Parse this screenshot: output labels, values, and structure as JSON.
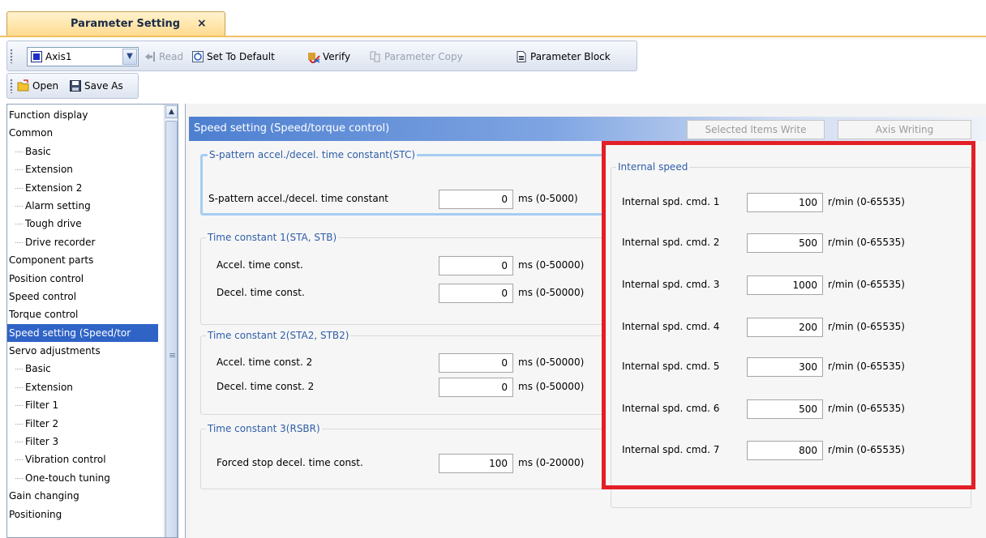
{
  "tab": {
    "title": "Parameter Setting",
    "close": "×"
  },
  "toolbar1": {
    "axis": "Axis1",
    "read": "Read",
    "set_to_default": "Set To Default",
    "verify": "Verify",
    "parameter_copy": "Parameter Copy",
    "parameter_block": "Parameter Block"
  },
  "toolbar2": {
    "open": "Open",
    "save_as": "Save As"
  },
  "tree": {
    "items": [
      {
        "label": "Function display",
        "level": 0
      },
      {
        "label": "Common",
        "level": 0
      },
      {
        "label": "Basic",
        "level": 1
      },
      {
        "label": "Extension",
        "level": 1
      },
      {
        "label": "Extension 2",
        "level": 1
      },
      {
        "label": "Alarm setting",
        "level": 1
      },
      {
        "label": "Tough drive",
        "level": 1
      },
      {
        "label": "Drive recorder",
        "level": 1
      },
      {
        "label": "Component parts",
        "level": 0
      },
      {
        "label": "Position control",
        "level": 0
      },
      {
        "label": "Speed control",
        "level": 0
      },
      {
        "label": "Torque control",
        "level": 0
      },
      {
        "label": "Speed setting (Speed/tor",
        "level": 0,
        "selected": true
      },
      {
        "label": "Servo adjustments",
        "level": 0
      },
      {
        "label": "Basic",
        "level": 1
      },
      {
        "label": "Extension",
        "level": 1
      },
      {
        "label": "Filter 1",
        "level": 1
      },
      {
        "label": "Filter 2",
        "level": 1
      },
      {
        "label": "Filter 3",
        "level": 1
      },
      {
        "label": "Vibration control",
        "level": 1
      },
      {
        "label": "One-touch tuning",
        "level": 1
      },
      {
        "label": "Gain changing",
        "level": 0
      },
      {
        "label": "Positioning",
        "level": 0
      }
    ]
  },
  "main": {
    "header": "Speed setting (Speed/torque control)",
    "selected_items_write": "Selected Items Write",
    "axis_writing": "Axis Writing",
    "stc": {
      "legend": "S-pattern accel./decel. time constant(STC)",
      "rows": [
        {
          "label": "S-pattern accel./decel. time constant",
          "value": "0",
          "unit": "ms (0-5000)"
        }
      ]
    },
    "tc1": {
      "legend": "Time constant 1(STA, STB)",
      "rows": [
        {
          "label": "Accel. time const.",
          "value": "0",
          "unit": "ms (0-50000)"
        },
        {
          "label": "Decel. time const.",
          "value": "0",
          "unit": "ms (0-50000)"
        }
      ]
    },
    "tc2": {
      "legend": "Time constant 2(STA2, STB2)",
      "rows": [
        {
          "label": "Accel. time const. 2",
          "value": "0",
          "unit": "ms (0-50000)"
        },
        {
          "label": "Decel. time const. 2",
          "value": "0",
          "unit": "ms (0-50000)"
        }
      ]
    },
    "tc3": {
      "legend": "Time constant 3(RSBR)",
      "rows": [
        {
          "label": "Forced stop decel. time const.",
          "value": "100",
          "unit": "ms (0-20000)"
        }
      ]
    },
    "internal": {
      "legend": "Internal speed",
      "rows": [
        {
          "label": "Internal spd. cmd. 1",
          "value": "100",
          "unit": "r/min (0-65535)"
        },
        {
          "label": "Internal spd. cmd. 2",
          "value": "500",
          "unit": "r/min (0-65535)"
        },
        {
          "label": "Internal spd. cmd. 3",
          "value": "1000",
          "unit": "r/min (0-65535)"
        },
        {
          "label": "Internal spd. cmd. 4",
          "value": "200",
          "unit": "r/min (0-65535)"
        },
        {
          "label": "Internal spd. cmd. 5",
          "value": "300",
          "unit": "r/min (0-65535)"
        },
        {
          "label": "Internal spd. cmd. 6",
          "value": "500",
          "unit": "r/min (0-65535)"
        },
        {
          "label": "Internal spd. cmd. 7",
          "value": "800",
          "unit": "r/min (0-65535)"
        }
      ]
    }
  },
  "colors": {
    "highlight": "#e31f26",
    "selection": "#2f63c6",
    "legend": "#2e5ea8",
    "header_blue": "#4d7fd0"
  }
}
